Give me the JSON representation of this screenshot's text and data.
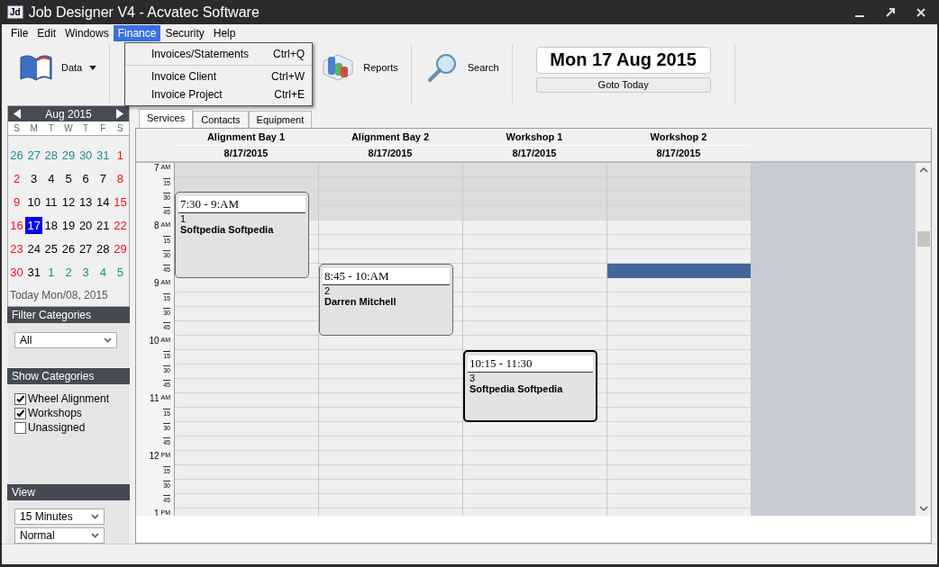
{
  "window": {
    "icon_text": "Jd",
    "title": "Job Designer V4 - Acvatec Software"
  },
  "menu": [
    {
      "label": "File",
      "selected": false
    },
    {
      "label": "Edit",
      "selected": false
    },
    {
      "label": "Windows",
      "selected": false
    },
    {
      "label": "Finance",
      "selected": true
    },
    {
      "label": "Security",
      "selected": false
    },
    {
      "label": "Help",
      "selected": false
    }
  ],
  "dropdown": [
    {
      "label": "Invoices/Statements",
      "shortcut": "Ctrl+Q",
      "separator_after": true
    },
    {
      "label": "Invoice Client",
      "shortcut": "Ctrl+W",
      "separator_after": false
    },
    {
      "label": "Invoice Project",
      "shortcut": "Ctrl+E",
      "separator_after": false
    }
  ],
  "toolbar": [
    {
      "label": "Data",
      "kind": "dropdown"
    },
    {
      "label": "Reports",
      "kind": "button"
    },
    {
      "label": "Search",
      "kind": "button"
    }
  ],
  "date_display": "Mon 17 Aug 2015",
  "goto_button": "Goto Today",
  "mini_calendar": {
    "month": "Aug 2015",
    "weekdays": [
      "S",
      "M",
      "T",
      "W",
      "T",
      "F",
      "S"
    ],
    "weeks": [
      [
        {
          "d": "26",
          "kind": "other",
          "selected": false
        },
        {
          "d": "27",
          "kind": "other",
          "selected": false
        },
        {
          "d": "28",
          "kind": "other",
          "selected": false
        },
        {
          "d": "29",
          "kind": "other",
          "selected": false
        },
        {
          "d": "30",
          "kind": "other",
          "selected": false
        },
        {
          "d": "31",
          "kind": "other",
          "selected": false
        },
        {
          "d": "1",
          "kind": "current",
          "selected": false
        }
      ],
      [
        {
          "d": "2",
          "kind": "current",
          "selected": false
        },
        {
          "d": "3",
          "kind": "current",
          "selected": false
        },
        {
          "d": "4",
          "kind": "current",
          "selected": false
        },
        {
          "d": "5",
          "kind": "current",
          "selected": false
        },
        {
          "d": "6",
          "kind": "current",
          "selected": false
        },
        {
          "d": "7",
          "kind": "current",
          "selected": false
        },
        {
          "d": "8",
          "kind": "current",
          "selected": false
        }
      ],
      [
        {
          "d": "9",
          "kind": "current",
          "selected": false
        },
        {
          "d": "10",
          "kind": "current",
          "selected": false
        },
        {
          "d": "11",
          "kind": "current",
          "selected": false
        },
        {
          "d": "12",
          "kind": "current",
          "selected": false
        },
        {
          "d": "13",
          "kind": "current",
          "selected": false
        },
        {
          "d": "14",
          "kind": "current",
          "selected": false
        },
        {
          "d": "15",
          "kind": "current",
          "selected": false
        }
      ],
      [
        {
          "d": "16",
          "kind": "current",
          "selected": false
        },
        {
          "d": "17",
          "kind": "current",
          "selected": true
        },
        {
          "d": "18",
          "kind": "current",
          "selected": false
        },
        {
          "d": "19",
          "kind": "current",
          "selected": false
        },
        {
          "d": "20",
          "kind": "current",
          "selected": false
        },
        {
          "d": "21",
          "kind": "current",
          "selected": false
        },
        {
          "d": "22",
          "kind": "current",
          "selected": false
        }
      ],
      [
        {
          "d": "23",
          "kind": "current",
          "selected": false
        },
        {
          "d": "24",
          "kind": "current",
          "selected": false
        },
        {
          "d": "25",
          "kind": "current",
          "selected": false
        },
        {
          "d": "26",
          "kind": "current",
          "selected": false
        },
        {
          "d": "27",
          "kind": "current",
          "selected": false
        },
        {
          "d": "28",
          "kind": "current",
          "selected": false
        },
        {
          "d": "29",
          "kind": "current",
          "selected": false
        }
      ],
      [
        {
          "d": "30",
          "kind": "current",
          "selected": false
        },
        {
          "d": "31",
          "kind": "current",
          "selected": false
        },
        {
          "d": "1",
          "kind": "other",
          "selected": false
        },
        {
          "d": "2",
          "kind": "other",
          "selected": false
        },
        {
          "d": "3",
          "kind": "other",
          "selected": false
        },
        {
          "d": "4",
          "kind": "other",
          "selected": false
        },
        {
          "d": "5",
          "kind": "other",
          "selected": false
        }
      ]
    ],
    "today": "Today Mon/08, 2015"
  },
  "filter_categories": {
    "title": "Filter Categories",
    "value": "All"
  },
  "show_categories": {
    "title": "Show Categories",
    "items": [
      {
        "label": "Wheel Alignment",
        "checked": true
      },
      {
        "label": "Workshops",
        "checked": true
      },
      {
        "label": "Unassigned",
        "checked": false
      }
    ]
  },
  "view": {
    "title": "View",
    "interval": "15 Minutes",
    "mode": "Normal"
  },
  "tabs": [
    {
      "label": "Services",
      "selected": true
    },
    {
      "label": "Contacts",
      "selected": false
    },
    {
      "label": "Equipment",
      "selected": false
    }
  ],
  "hours": [
    {
      "label": "7",
      "suffix": "AM",
      "kind": "closed",
      "quarters": [
        "15",
        "30",
        "45"
      ]
    },
    {
      "label": "8",
      "suffix": "AM",
      "kind": "open",
      "quarters": [
        "15",
        "30",
        "45"
      ]
    },
    {
      "label": "9",
      "suffix": "AM",
      "kind": "open",
      "quarters": [
        "15",
        "30",
        "45"
      ]
    },
    {
      "label": "10",
      "suffix": "AM",
      "kind": "open",
      "quarters": [
        "15",
        "30",
        "45"
      ]
    },
    {
      "label": "11",
      "suffix": "AM",
      "kind": "open",
      "quarters": [
        "15",
        "30",
        "45"
      ]
    },
    {
      "label": "12",
      "suffix": "PM",
      "kind": "open",
      "quarters": [
        "15",
        "30",
        "45"
      ]
    },
    {
      "label": "1",
      "suffix": "PM",
      "kind": "open"
    }
  ],
  "resources": [
    {
      "name": "Alignment Bay 1",
      "date": "8/17/2015",
      "items": [
        {
          "kind": "job",
          "time": "7:30 - 9:AM",
          "number": "1",
          "client": "Softpedia Softpedia",
          "selected": false
        }
      ]
    },
    {
      "name": "Alignment Bay 2",
      "date": "8/17/2015",
      "items": [
        {
          "kind": "job",
          "time": "8:45 - 10:AM",
          "number": "2",
          "client": "Darren Mitchell",
          "selected": false
        }
      ]
    },
    {
      "name": "Workshop 1",
      "date": "8/17/2015",
      "items": [
        {
          "kind": "job",
          "time": "10:15 - 11:30",
          "number": "3",
          "client": "Softpedia Softpedia",
          "selected": true
        }
      ]
    },
    {
      "name": "Workshop 2",
      "date": "8/17/2015",
      "items": [
        {
          "kind": "selection"
        }
      ]
    }
  ]
}
